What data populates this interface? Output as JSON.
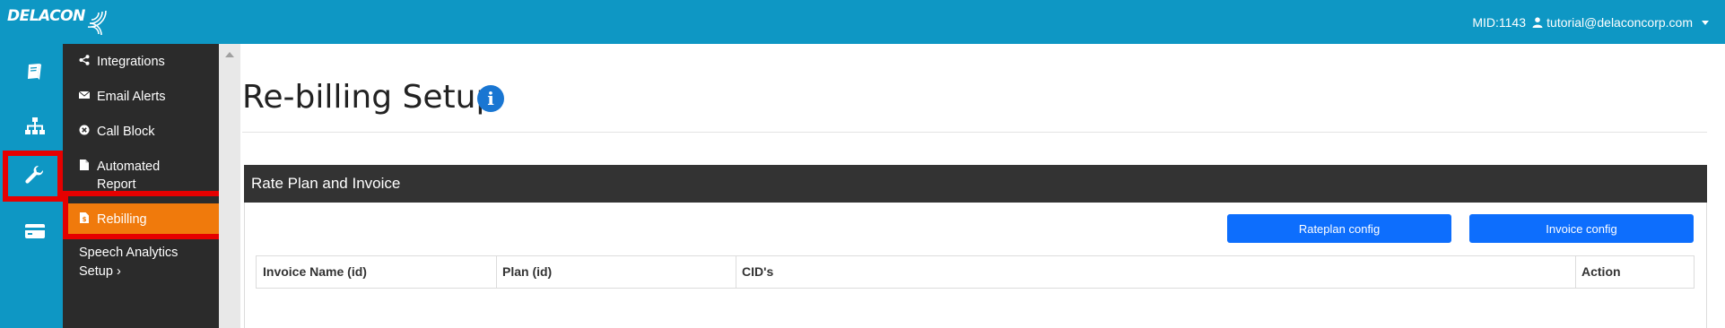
{
  "header": {
    "logo_text": "DELACON",
    "mid_label": "MID:1143",
    "user_email": "tutorial@delaconcorp.com"
  },
  "rail": {
    "icons": [
      "book-icon",
      "sitemap-icon",
      "wrench-icon",
      "credit-card-icon"
    ],
    "active": "wrench-icon"
  },
  "submenu": {
    "items": [
      {
        "label": "Integrations",
        "icon": "share-icon"
      },
      {
        "label": "Email Alerts",
        "icon": "envelope-icon"
      },
      {
        "label": "Call Block",
        "icon": "times-circle-icon"
      },
      {
        "label": "Automated",
        "label2": "Report",
        "icon": "file-icon"
      },
      {
        "label": "Rebilling",
        "icon": "file-invoice-icon"
      }
    ],
    "speech_line1": "Speech Analytics",
    "speech_line2": "Setup",
    "speech_chevron": "›",
    "active": "Rebilling"
  },
  "main": {
    "title": "Re-billing Setup",
    "info_glyph": "i"
  },
  "panel": {
    "title": "Rate Plan and Invoice",
    "rateplan_button": "Rateplan config",
    "invoice_button": "Invoice config",
    "columns": [
      "Invoice Name (id)",
      "Plan (id)",
      "CID's",
      "Action"
    ]
  },
  "colors": {
    "brand": "#0e97c4",
    "submenu_bg": "#2b2b2b",
    "active_item": "#f07a0c",
    "highlight_box": "#e60000",
    "button": "#0d6efd",
    "panel_header": "#333333"
  }
}
